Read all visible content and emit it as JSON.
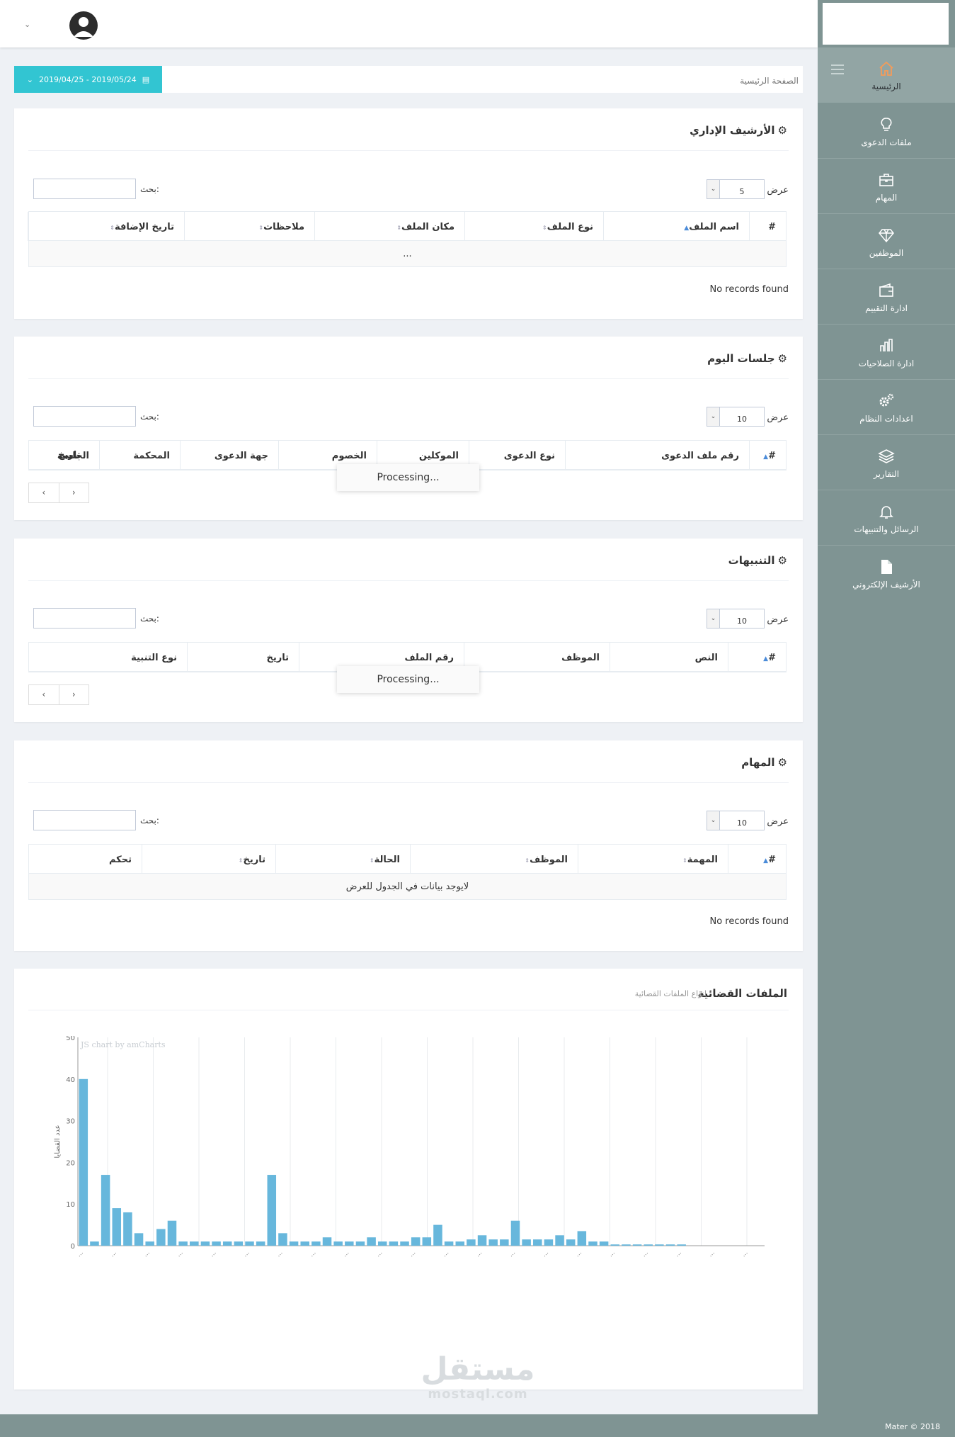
{
  "sidebar": {
    "items": [
      {
        "label": "الرئيسية",
        "icon": "home-icon"
      },
      {
        "label": "ملفات الدعوى",
        "icon": "lightbulb-icon"
      },
      {
        "label": "المهام",
        "icon": "briefcase-icon"
      },
      {
        "label": "الموظفين",
        "icon": "diamond-icon"
      },
      {
        "label": "ادارة التقييم",
        "icon": "wallet-icon"
      },
      {
        "label": "ادارة الصلاحيات",
        "icon": "bar-chart-icon"
      },
      {
        "label": "اعدادات النظام",
        "icon": "gears-icon"
      },
      {
        "label": "التقارير",
        "icon": "layers-icon"
      },
      {
        "label": "الرسائل والتنبيهات",
        "icon": "bell-icon"
      },
      {
        "label": "الأرشيف الإلكتروني",
        "icon": "document-icon"
      }
    ]
  },
  "footer": {
    "copyright": "Mater © 2018"
  },
  "breadcrumb": {
    "home": "الصفحة الرئيسية"
  },
  "date_range": {
    "value": "2019/04/25 - 2019/05/24"
  },
  "common": {
    "show_label": "عرض",
    "search_label": "بحث:",
    "no_records": "No records found",
    "processing": "Processing...",
    "prev": "‹",
    "next": "›"
  },
  "archive": {
    "title": "الأرشيف الإداري",
    "page_length": "5",
    "columns": [
      "#",
      "اسم الملف",
      "نوع الملف",
      "مكان الملف",
      "ملاحظات",
      "تاريخ الإضافة"
    ],
    "empty_row": "..."
  },
  "sessions": {
    "title": "جلسات اليوم",
    "page_length": "10",
    "columns": [
      "#",
      "رقم ملف الدعوى",
      "نوع الدعوى",
      "الموكلين",
      "الخصوم",
      "جهة الدعوى",
      "المحكمة",
      "الجلسة",
      "تاريخ"
    ]
  },
  "alerts": {
    "title": "التنبيهات",
    "page_length": "10",
    "columns": [
      "#",
      "النص",
      "الموظف",
      "رقم الملف",
      "تاريخ",
      "نوع التنبية"
    ]
  },
  "tasks": {
    "title": "المهام",
    "page_length": "10",
    "columns": [
      "#",
      "المهمة",
      "الموظف",
      "الحالة",
      "تاريخ",
      "تحكم"
    ],
    "empty_row": "لايوجد بيانات في الجدول للعرض"
  },
  "chart_panel": {
    "title": "الملفات القضائية",
    "subtitle": "انواع الملفات القضائية",
    "credit": "JS chart by amCharts"
  },
  "chart_data": {
    "type": "bar",
    "ylabel": "عدد القضايا",
    "ylim": [
      0,
      50
    ],
    "yticks": [
      0,
      10,
      20,
      30,
      40,
      50
    ],
    "grid": true,
    "color": "#67b7dc",
    "categories": [
      "...",
      "...",
      "...",
      "...",
      "...",
      "...",
      "...",
      "...",
      "...",
      "...",
      "...",
      "...",
      "...",
      "...",
      "...",
      "...",
      "...",
      "...",
      "...",
      "...",
      "...",
      "...",
      "...",
      "...",
      "...",
      "...",
      "...",
      "...",
      "...",
      "...",
      "...",
      "...",
      "...",
      "...",
      "...",
      "...",
      "...",
      "...",
      "...",
      "...",
      "...",
      "...",
      "...",
      "...",
      "...",
      "...",
      "...",
      "...",
      "...",
      "...",
      "...",
      "...",
      "...",
      "...",
      "...",
      "...",
      "...",
      "...",
      "...",
      "...",
      "...",
      "..."
    ],
    "values": [
      40,
      1,
      17,
      9,
      8,
      3,
      1,
      4,
      6,
      1,
      1,
      1,
      1,
      1,
      1,
      1,
      1,
      17,
      3,
      1,
      1,
      1,
      2,
      1,
      1,
      1,
      2,
      1,
      1,
      1,
      2,
      2,
      5,
      1,
      1,
      1.5,
      2.5,
      1.5,
      1.5,
      6,
      1.5,
      1.5,
      1.5,
      2.5,
      1.5,
      3.5,
      1,
      1,
      0.3,
      0.3,
      0.3,
      0.3,
      0.3,
      0.3,
      0.3,
      0,
      0,
      0,
      0,
      0,
      0,
      0
    ]
  }
}
